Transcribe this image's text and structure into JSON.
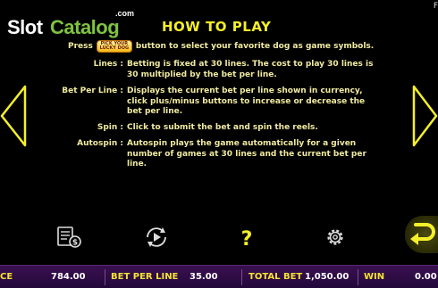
{
  "watermark": {
    "com": ".com",
    "slot": "Slot",
    "catalog": "Catalog"
  },
  "corner_text": "F",
  "title": "HOW TO PLAY",
  "press": {
    "before": "Press",
    "button_line1": "PICK YOUR",
    "button_line2": "LUCKY DOG",
    "after": "button to select your favorite dog as game symbols."
  },
  "rules": [
    {
      "label": "Lines :",
      "text": "Betting is fixed at 30 lines. The cost to play 30 lines is 30 multiplied by the bet per line."
    },
    {
      "label": "Bet Per Line :",
      "text": "Displays the current bet per line shown in currency, click plus/minus buttons to increase or decrease the bet per line."
    },
    {
      "label": "Spin :",
      "text": "Click to submit the bet and spin the reels."
    },
    {
      "label": "Autospin :",
      "text": "Autospin plays the game automatically for a given number of games at 30 lines and the current bet per line."
    }
  ],
  "toolbar_icons": [
    "paytable-money-icon",
    "autoplay-icon",
    "help-icon",
    "settings-gear-icon",
    "back-arrow-icon"
  ],
  "status": {
    "balance_label": "CE",
    "balance_value": "784.00",
    "bet_label": "BET PER LINE",
    "bet_value": "35.00",
    "total_label": "TOTAL BET",
    "total_value": "1,050.00",
    "win_label": "WIN",
    "win_value": "0.00"
  },
  "colors": {
    "accent_yellow": "#f5ef2a",
    "text_cream": "#f0eaa0",
    "status_bg": "#2a0c42",
    "logo_green": "#7fc241"
  }
}
